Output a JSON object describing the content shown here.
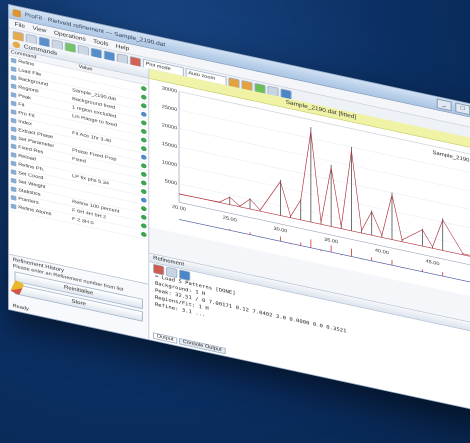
{
  "window": {
    "title": "ProFit · Rietveld refinement — Sample_2190.dat",
    "controls": [
      "_",
      "□",
      "×"
    ]
  },
  "menu": [
    "File",
    "View",
    "Operations",
    "Tools",
    "Help"
  ],
  "toolbar": {
    "select1": "Plot mode",
    "select2": "Auto zoom"
  },
  "left_panel": {
    "title": "Commands",
    "header_cols": [
      "Command",
      "Value"
    ],
    "rows": [
      {
        "k": "Refine",
        "v": ""
      },
      {
        "k": "Load File",
        "v": ""
      },
      {
        "k": "Background",
        "v": "Sample_2190.dat"
      },
      {
        "k": "Regions",
        "v": "Background fixed"
      },
      {
        "k": "Peak",
        "v": "1 region excluded"
      },
      {
        "k": "Fit",
        "v": "Lin Range to fixed"
      },
      {
        "k": "Pro Fit",
        "v": ""
      },
      {
        "k": "Index",
        "v": "Fit Ace 1hr 3.40"
      },
      {
        "k": "Extract Phase",
        "v": ""
      },
      {
        "k": "Set Parameter",
        "v": "Phase Fixed Prop"
      },
      {
        "k": "Fixed Res",
        "v": "Fixed"
      },
      {
        "k": "Reload",
        "v": ""
      },
      {
        "k": "Refine Ph.",
        "v": "LP fix phs 5.34"
      },
      {
        "k": "Set Coord",
        "v": ""
      },
      {
        "k": "Set Weight",
        "v": ""
      },
      {
        "k": "Statistics",
        "v": "Refine 100 percent"
      },
      {
        "k": "Pointers",
        "v": "F 6H 4H 5H 2"
      },
      {
        "k": "Refine Atoms",
        "v": "F 2 3H 0"
      }
    ],
    "bottom_title": "Refinement History",
    "bottom_sub": "Please enter an Refinement number from list",
    "btn_history": "Reinitialise",
    "btn_store": "Store",
    "footer": "Ready"
  },
  "chart_header": "Sample_2190.dat [fitted]",
  "chart_data": {
    "type": "line",
    "title": "",
    "legend": "Sample_2190.dat",
    "ylabel": "",
    "y_ticks": [
      "30000",
      "25000",
      "20000",
      "15000",
      "10000",
      "5000"
    ],
    "x_ticks": [
      "20.00",
      "25.00",
      "30.00",
      "35.00",
      "40.00",
      "45.00",
      "50.00"
    ],
    "x": [
      20,
      22,
      24,
      25,
      26,
      27,
      28,
      30,
      31,
      32,
      33,
      34,
      35,
      36,
      37,
      38,
      39,
      40,
      41,
      42,
      44,
      45,
      46,
      48,
      50
    ],
    "observed": [
      2300,
      2400,
      2500,
      4500,
      2600,
      5200,
      2700,
      12000,
      2800,
      8000,
      28000,
      3000,
      19000,
      3000,
      25000,
      3100,
      9000,
      3000,
      15000,
      2900,
      7000,
      2800,
      11000,
      2700,
      2600
    ],
    "difference": [
      0,
      100,
      -80,
      600,
      -150,
      900,
      -200,
      1800,
      -300,
      1200,
      3200,
      -500,
      2600,
      -400,
      3000,
      -300,
      1400,
      -200,
      2000,
      -200,
      900,
      -100,
      1500,
      -80,
      0
    ]
  },
  "console": {
    "title": "Refinement",
    "lines": [
      "> Load 5 Patterns [DONE]",
      "  Background: 1 H",
      "  Peak: 32.51 / 0 7.00171 0.12 7.0402 3.0 0.0000 0.0 0.3521",
      "  Regions/Fit: 1 H",
      "  Refine: 3.1 ..."
    ],
    "tabs": [
      "Output",
      "Console Output"
    ]
  }
}
